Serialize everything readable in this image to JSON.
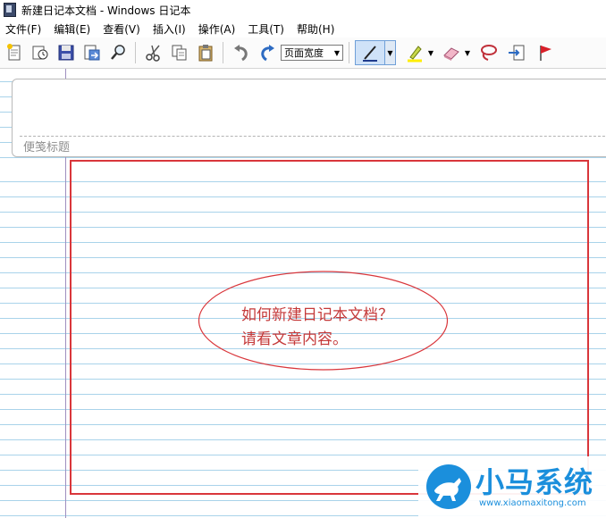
{
  "window": {
    "title": "新建日记本文档 - Windows 日记本"
  },
  "menu": {
    "items": [
      "文件(F)",
      "编辑(E)",
      "查看(V)",
      "插入(I)",
      "操作(A)",
      "工具(T)",
      "帮助(H)"
    ]
  },
  "toolbar": {
    "zoom_value": "页面宽度",
    "icons": [
      "new-note-icon",
      "open-icon",
      "save-icon",
      "export-icon",
      "find-icon",
      "cut-icon",
      "copy-icon",
      "paste-icon",
      "undo-icon",
      "redo-icon",
      "pen-icon",
      "highlighter-icon",
      "eraser-icon",
      "lasso-icon",
      "insert-space-icon",
      "flag-icon"
    ]
  },
  "note": {
    "title_placeholder": "便笺标题",
    "annotation_line1": "如何新建日记本文档？",
    "annotation_line2": "请看文章内容。"
  },
  "watermark": {
    "name": "小马系统",
    "url": "www.xiaomaxitong.com"
  },
  "colors": {
    "annotation_red": "#d9363b",
    "ruled_line": "#a9d3ea",
    "margin_line": "#9e8fbf",
    "watermark_blue": "#1b8fdc"
  }
}
